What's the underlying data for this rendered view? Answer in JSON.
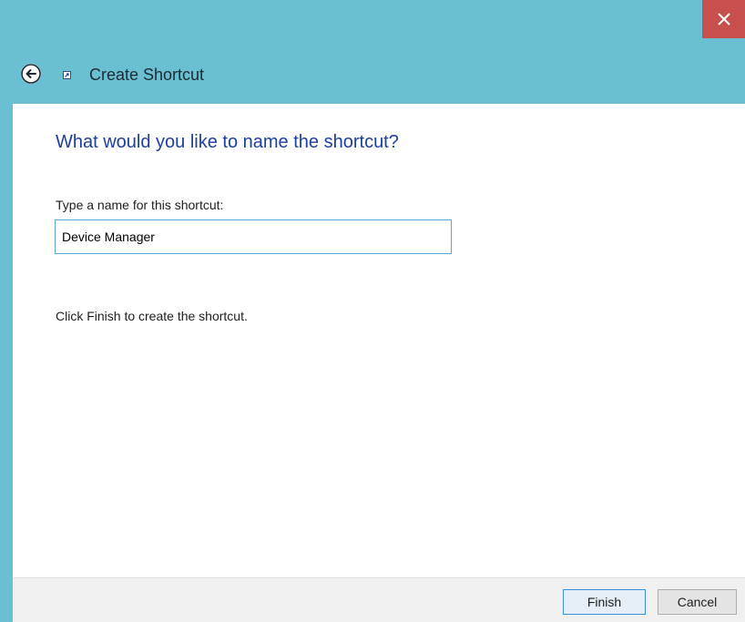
{
  "window": {
    "title": "Create Shortcut",
    "close_icon": "close-icon",
    "back_icon": "back-arrow-icon",
    "shortcut_icon": "shortcut-icon",
    "titlebar_color": "#6bbfd2",
    "close_color": "#c7504f"
  },
  "main": {
    "heading": "What would you like to name the shortcut?",
    "heading_color": "#1c3fa0",
    "field_label": "Type a name for this shortcut:",
    "name_value": "Device Manager",
    "hint": "Click Finish to create the shortcut."
  },
  "footer": {
    "finish_label": "Finish",
    "cancel_label": "Cancel"
  }
}
